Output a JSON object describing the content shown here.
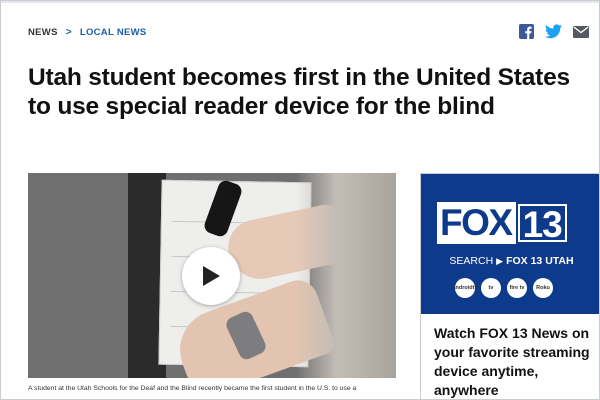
{
  "breadcrumb": {
    "items": [
      "NEWS",
      "LOCAL NEWS"
    ],
    "separator": ">"
  },
  "share": {
    "icons": [
      "facebook-icon",
      "twitter-icon",
      "email-icon"
    ]
  },
  "article": {
    "headline": "Utah student becomes first in the United States to use special reader device for the blind",
    "caption": "A student at the Utah Schools for the Deaf and the Blind recently became the first student in the U.S. to use a"
  },
  "video": {
    "play_icon": "play-icon"
  },
  "ad": {
    "logo_fox": "FOX",
    "logo_number": "13",
    "search_word": "SEARCH",
    "search_target": "FOX 13 UTAH",
    "apps": [
      "androidtv",
      "tv",
      "fire tv",
      "Roku"
    ],
    "promo": "Watch FOX 13 News on your favorite streaming device anytime, anywhere"
  },
  "colors": {
    "link_blue": "#1b5fa6",
    "fox_blue": "#0e3a8c",
    "facebook": "#3b5998",
    "twitter": "#1da1f2"
  }
}
